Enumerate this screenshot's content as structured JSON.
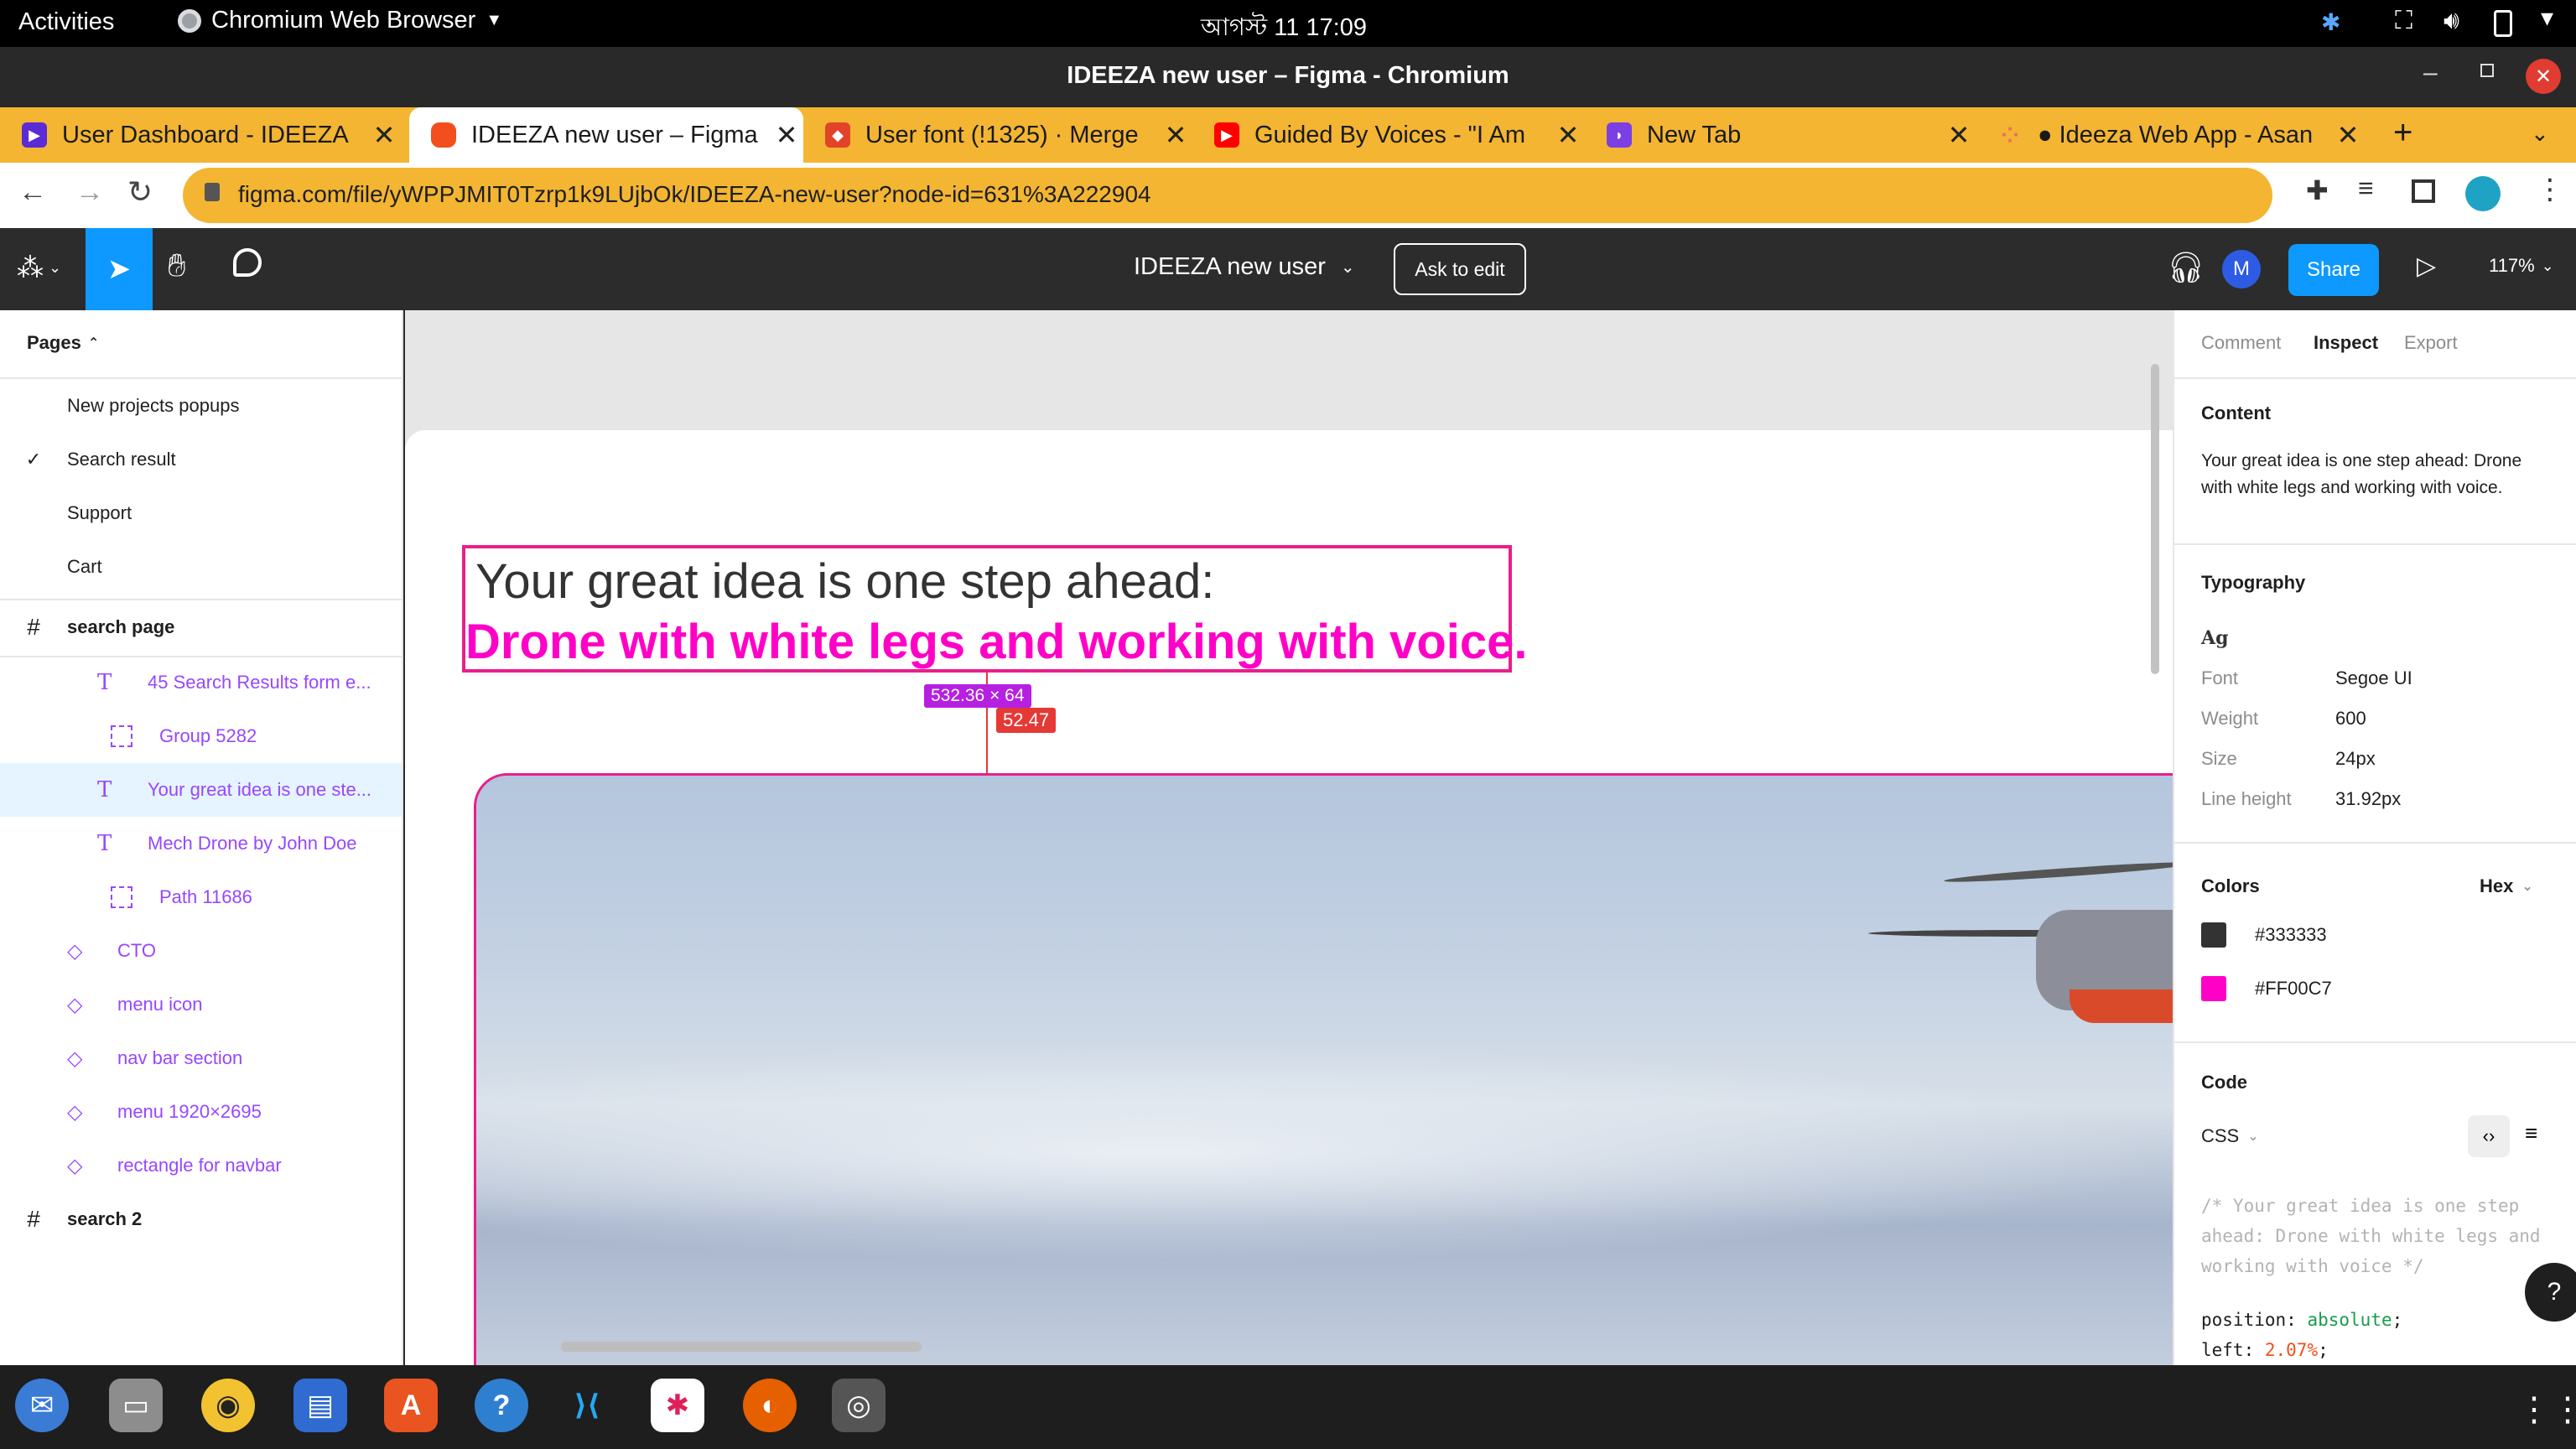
{
  "system_bar": {
    "activities": "Activities",
    "app_menu": "Chromium Web Browser",
    "clock": "আগস্ট 11  17:09"
  },
  "window": {
    "title": "IDEEZA new user – Figma - Chromium"
  },
  "tabs": [
    {
      "title": "User Dashboard - IDEEZA",
      "favicon_color": "#5b2bd6"
    },
    {
      "title": "IDEEZA new user – Figma",
      "favicon_color": "#f24e1e"
    },
    {
      "title": "User font (!1325) · Merge",
      "favicon_color": "#e24329"
    },
    {
      "title": "Guided By Voices - \"I Am",
      "favicon_color": "#ff0000"
    },
    {
      "title": "New Tab",
      "favicon_color": "#7b3fe4"
    },
    {
      "title": "● Ideeza Web App - Asan",
      "favicon_color": "#f06a6a"
    }
  ],
  "address": {
    "url": "figma.com/file/yWPPJMIT0Tzrp1k9LUjbOk/IDEEZA-new-user?node-id=631%3A222904"
  },
  "figma_toolbar": {
    "file_name": "IDEEZA new user",
    "ask_to_edit": "Ask to edit",
    "avatar_initial": "M",
    "share": "Share",
    "zoom": "117%"
  },
  "pages": {
    "header": "Pages",
    "items": [
      {
        "label": "New projects popups",
        "checked": false
      },
      {
        "label": "Search result",
        "checked": true
      },
      {
        "label": "Support",
        "checked": false
      },
      {
        "label": "Cart",
        "checked": false
      }
    ]
  },
  "layers": {
    "frame": "search page",
    "children": [
      {
        "label": "45 Search Results form e...",
        "kind": "text"
      },
      {
        "label": "Group 5282",
        "kind": "group"
      },
      {
        "label": "Your great idea is one ste...",
        "kind": "text",
        "selected": true
      },
      {
        "label": "Mech Drone by John Doe",
        "kind": "text"
      },
      {
        "label": "Path 11686",
        "kind": "group"
      },
      {
        "label": "CTO",
        "kind": "component"
      },
      {
        "label": "menu icon",
        "kind": "component"
      },
      {
        "label": "nav bar section",
        "kind": "component"
      },
      {
        "label": "menu 1920×2695",
        "kind": "component"
      },
      {
        "label": "rectangle for navbar",
        "kind": "component"
      }
    ],
    "frame2": "search 2"
  },
  "canvas": {
    "line1": "Your great idea is one step ahead:",
    "line2": "Drone with white legs and working with voice.",
    "size_badge": "532.36 × 64",
    "distance_badge": "52.47"
  },
  "inspect": {
    "tabs": [
      "Comment",
      "Inspect",
      "Export"
    ],
    "active_tab": "Inspect",
    "content_title": "Content",
    "content_text": "Your great idea is one step ahead: Drone with white legs and working with voice.",
    "typography_title": "Typography",
    "ag": "Ag",
    "font_label": "Font",
    "font_value": "Segoe UI",
    "weight_label": "Weight",
    "weight_value": "600",
    "size_label": "Size",
    "size_value": "24px",
    "lh_label": "Line height",
    "lh_value": "31.92px",
    "colors_title": "Colors",
    "color_mode": "Hex",
    "colors": [
      {
        "hex": "#333333"
      },
      {
        "hex": "#FF00C7"
      }
    ],
    "code_title": "Code",
    "code_lang": "CSS",
    "code_comment": "/* Your great idea is one step ahead: Drone with white legs and working with voice */",
    "code_prop1": "position",
    "code_val1": "absolute",
    "code_prop2": "left",
    "code_val2": "2.07%",
    "help": "?"
  }
}
